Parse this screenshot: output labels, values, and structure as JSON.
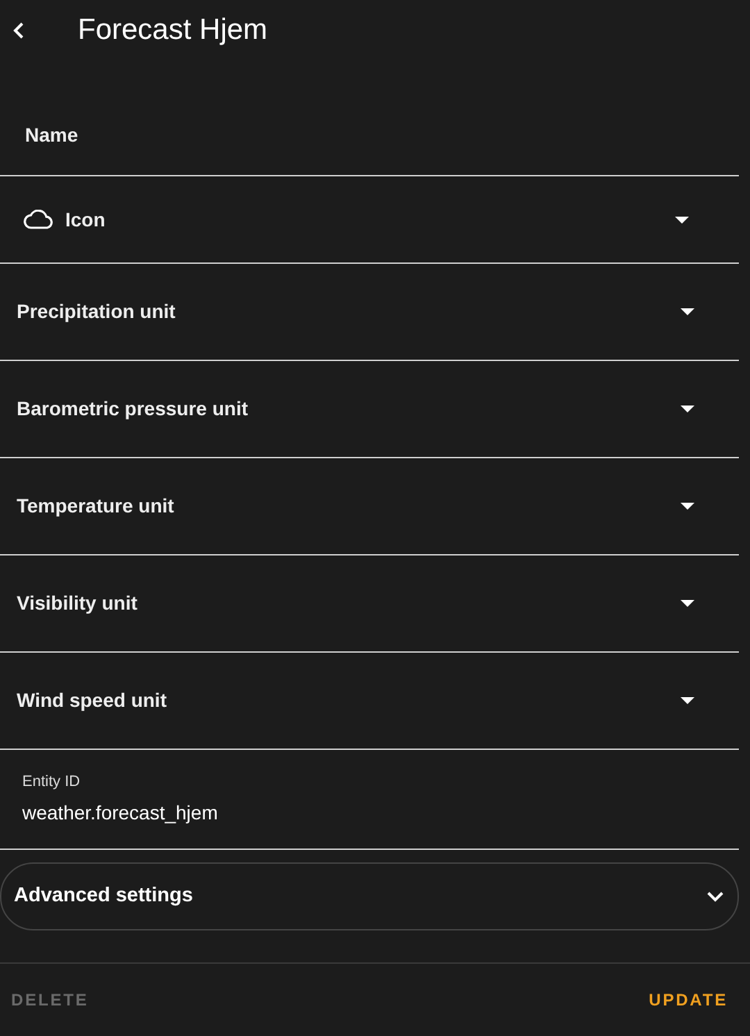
{
  "header": {
    "title": "Forecast Hjem"
  },
  "fields": [
    {
      "kind": "text",
      "placeholder": "Name"
    },
    {
      "kind": "icon-select",
      "label": "Icon"
    },
    {
      "kind": "select",
      "label": "Precipitation unit"
    },
    {
      "kind": "select",
      "label": "Barometric pressure unit"
    },
    {
      "kind": "select",
      "label": "Temperature unit"
    },
    {
      "kind": "select",
      "label": "Visibility unit"
    },
    {
      "kind": "select",
      "label": "Wind speed unit"
    },
    {
      "kind": "labeled-text",
      "label": "Entity ID",
      "value": "weather.forecast_hjem"
    }
  ],
  "advanced": {
    "label": "Advanced settings",
    "expanded": false
  },
  "actions": [
    {
      "label": "DELETE",
      "disabled": true
    },
    {
      "label": "UPDATE",
      "disabled": false
    }
  ]
}
